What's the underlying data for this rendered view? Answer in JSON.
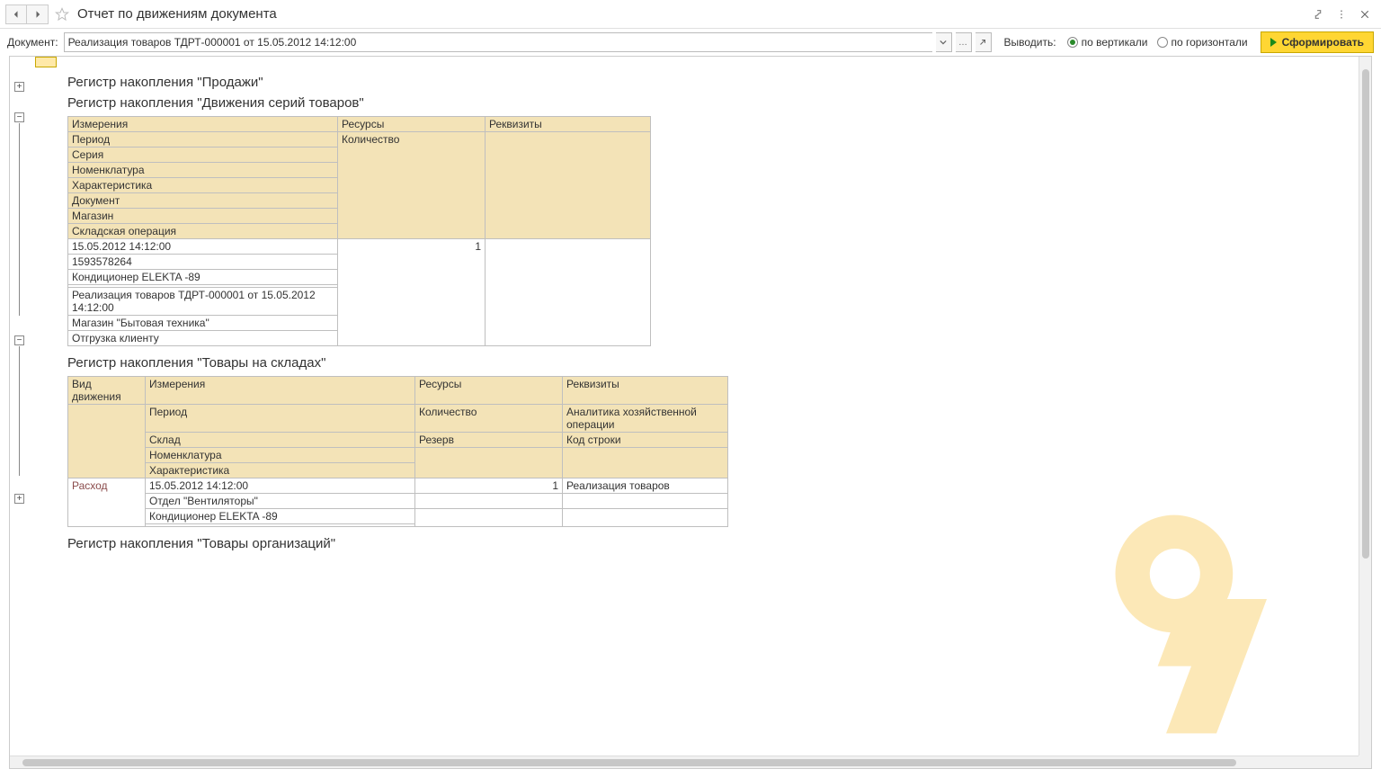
{
  "titlebar": {
    "title": "Отчет по движениям документа"
  },
  "toolbar": {
    "doc_label": "Документ:",
    "doc_value": "Реализация товаров ТДРТ-000001 от 15.05.2012 14:12:00",
    "output_label": "Выводить:",
    "radio_vertical": "по вертикали",
    "radio_horizontal": "по горизонтали",
    "form_button": "Сформировать"
  },
  "section1": {
    "title": "Регистр накопления \"Продажи\""
  },
  "section2": {
    "title": "Регистр накопления \"Движения серий товаров\"",
    "headers": {
      "dimensions": "Измерения",
      "resources": "Ресурсы",
      "requisites": "Реквизиты"
    },
    "subheaders": {
      "period": "Период",
      "series": "Серия",
      "nomenclature": "Номенклатура",
      "characteristic": "Характеристика",
      "document": "Документ",
      "store": "Магазин",
      "warehouse_op": "Складская операция",
      "quantity": "Количество"
    },
    "data": {
      "period": "15.05.2012 14:12:00",
      "series": "1593578264",
      "nomenclature": "Кондиционер ELEKTA -89",
      "characteristic": "",
      "document": "Реализация товаров ТДРТ-000001 от 15.05.2012 14:12:00",
      "store": "Магазин \"Бытовая техника\"",
      "warehouse_op": "Отгрузка клиенту",
      "quantity": "1"
    }
  },
  "section3": {
    "title": "Регистр накопления \"Товары на складах\"",
    "headers": {
      "movement_type": "Вид движения",
      "dimensions": "Измерения",
      "resources": "Ресурсы",
      "requisites": "Реквизиты"
    },
    "subheaders": {
      "period": "Период",
      "warehouse": "Склад",
      "nomenclature": "Номенклатура",
      "characteristic": "Характеристика",
      "quantity": "Количество",
      "reserve": "Резерв",
      "analytics": "Аналитика хозяйственной операции",
      "line_code": "Код строки"
    },
    "data": {
      "movement_type": "Расход",
      "period": "15.05.2012 14:12:00",
      "warehouse": "Отдел  \"Вентиляторы\"",
      "nomenclature": "Кондиционер ELEKTA -89",
      "characteristic": "",
      "quantity": "1",
      "reserve": "",
      "analytics": "Реализация товаров",
      "line_code": ""
    }
  },
  "section4": {
    "title": "Регистр накопления \"Товары организаций\""
  }
}
